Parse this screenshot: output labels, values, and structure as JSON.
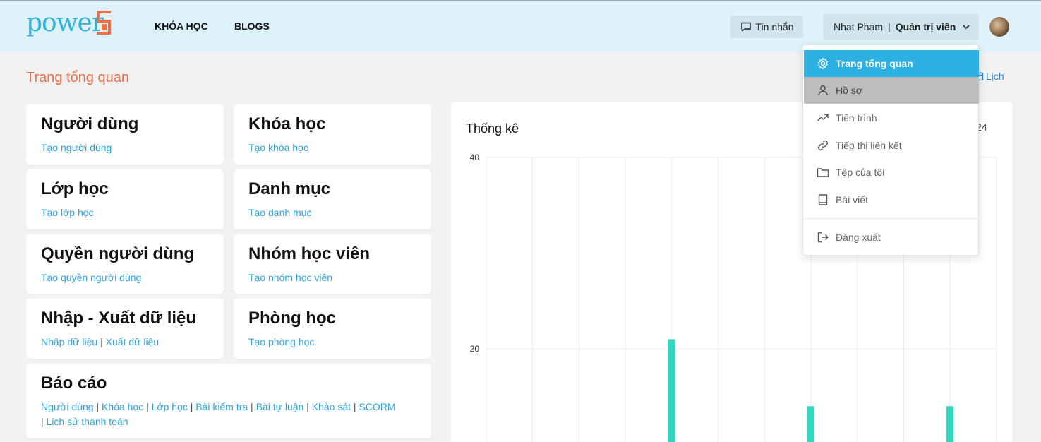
{
  "header": {
    "logo_text": "power",
    "logo_mark": "5",
    "nav": [
      {
        "label": "KHÓA HỌC"
      },
      {
        "label": "BLOGS"
      }
    ],
    "messages_label": "Tin nhắn",
    "user": {
      "name": "Nhat Pham",
      "separator": "|",
      "role": "Quản trị viên"
    },
    "colors": {
      "header_bg": "#dff1f9",
      "logo": "#2fb3d8",
      "logo_mark": "#e8704a"
    }
  },
  "page": {
    "title": "Trang tổng quan",
    "calendar_label": "Lịch"
  },
  "cards": [
    {
      "title": "Người dùng",
      "links": [
        "Tạo người dùng"
      ]
    },
    {
      "title": "Khóa học",
      "links": [
        "Tạo khóa học"
      ]
    },
    {
      "title": "Lớp học",
      "links": [
        "Tạo lớp học"
      ]
    },
    {
      "title": "Danh mục",
      "links": [
        "Tạo danh mục"
      ]
    },
    {
      "title": "Quyền người dùng",
      "links": [
        "Tạo quyền người dùng"
      ]
    },
    {
      "title": "Nhóm học viên",
      "links": [
        "Tạo nhóm học viên"
      ]
    },
    {
      "title": "Nhập - Xuất dữ liệu",
      "links": [
        "Nhập dữ liệu",
        "Xuất dữ liệu"
      ]
    },
    {
      "title": "Phòng học",
      "links": [
        "Tạo phòng học"
      ]
    },
    {
      "title": "Báo cáo",
      "links": [
        "Người dùng",
        "Khóa học",
        "Lớp học",
        "Bài kiểm tra",
        "Bài tự luận",
        "Khảo sát",
        "SCORM",
        "Lịch sử thanh toán"
      ]
    }
  ],
  "stats": {
    "title": "Thống kê",
    "year_partial": "24"
  },
  "chart_data": {
    "type": "bar",
    "y_ticks": [
      "40",
      "20"
    ],
    "ylim": [
      0,
      40
    ],
    "grid": true,
    "bar_color": "#2ddbc3",
    "column_count": 11,
    "bars": [
      {
        "column": 4,
        "value": 21
      },
      {
        "column": 7,
        "value": 14
      },
      {
        "column": 10,
        "value": 14
      }
    ]
  },
  "menu": {
    "items": [
      {
        "label": "Trang tổng quan",
        "icon": "gear-icon",
        "state": "active"
      },
      {
        "label": "Hồ sơ",
        "icon": "user-icon",
        "state": "hover"
      },
      {
        "label": "Tiến trình",
        "icon": "trend-up-icon",
        "state": ""
      },
      {
        "label": "Tiếp thị liên kết",
        "icon": "link-icon",
        "state": ""
      },
      {
        "label": "Tệp của tôi",
        "icon": "folder-icon",
        "state": ""
      },
      {
        "label": "Bài viết",
        "icon": "book-icon",
        "state": ""
      }
    ],
    "logout": {
      "label": "Đăng xuất",
      "icon": "logout-icon"
    }
  }
}
